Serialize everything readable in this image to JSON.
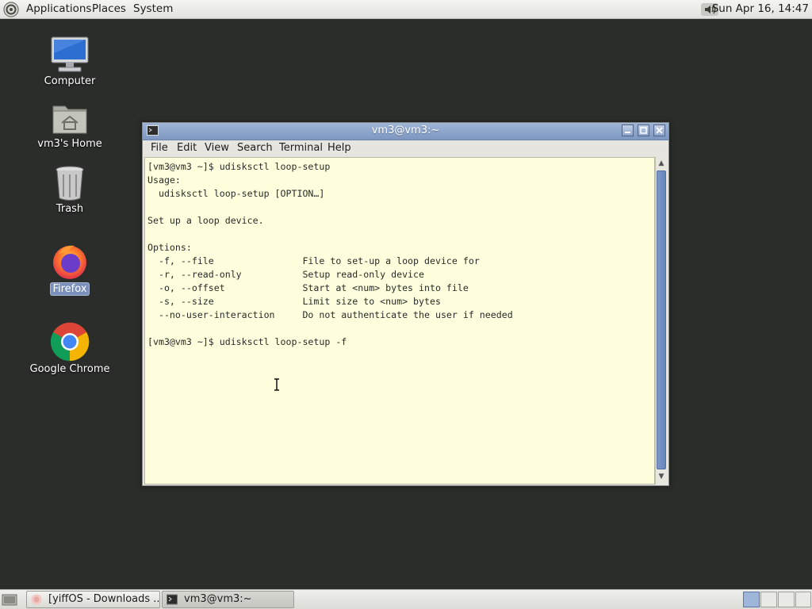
{
  "top_panel": {
    "menus": [
      "Applications",
      "Places",
      "System"
    ],
    "clock": "Sun Apr 16, 14:47"
  },
  "desktop": {
    "icons": [
      {
        "label": "Computer",
        "icon": "computer-icon"
      },
      {
        "label": "vm3's Home",
        "icon": "home-folder-icon"
      },
      {
        "label": "Trash",
        "icon": "trash-icon"
      },
      {
        "label": "Firefox",
        "icon": "firefox-icon",
        "selected": true
      },
      {
        "label": "Google Chrome",
        "icon": "chrome-icon"
      }
    ]
  },
  "terminal": {
    "title": "vm3@vm3:~",
    "menu": [
      "File",
      "Edit",
      "View",
      "Search",
      "Terminal",
      "Help"
    ],
    "lines": [
      "[vm3@vm3 ~]$ udisksctl loop-setup",
      "Usage:",
      "  udisksctl loop-setup [OPTION…]",
      "",
      "Set up a loop device.",
      "",
      "Options:",
      "  -f, --file                File to set-up a loop device for",
      "  -r, --read-only           Setup read-only device",
      "  -o, --offset              Start at <num> bytes into file",
      "  -s, --size                Limit size to <num> bytes",
      "  --no-user-interaction     Do not authenticate the user if needed",
      "",
      "[vm3@vm3 ~]$ udisksctl loop-setup -f"
    ],
    "background": "#ffffdd"
  },
  "taskbar": {
    "tasks": [
      {
        "label": "[yiffOS - Downloads ...",
        "icon": "browser-icon"
      },
      {
        "label": "vm3@vm3:~",
        "icon": "terminal-icon",
        "active": true
      }
    ],
    "workspaces": 4,
    "active_workspace": 1
  },
  "colors": {
    "desktop_bg": "#2b2d2b",
    "titlebar": "#8aa2c8",
    "scroll_thumb": "#6f8cc0"
  }
}
